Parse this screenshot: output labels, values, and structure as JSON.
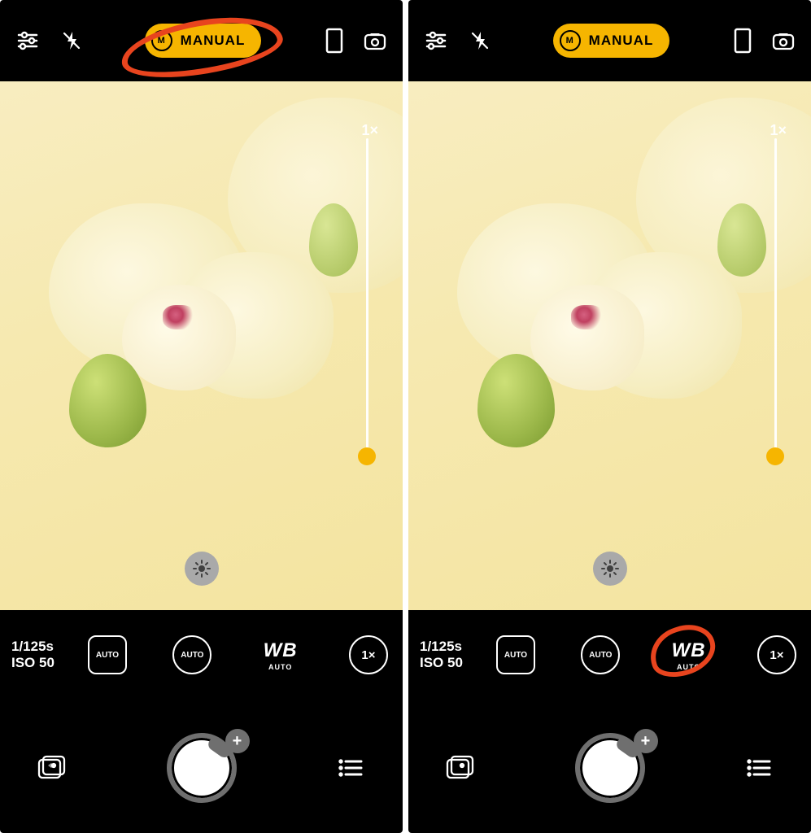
{
  "mode": {
    "badge_letter": "M",
    "label": "MANUAL"
  },
  "zoom": {
    "label": "1×"
  },
  "exposure": {
    "shutter": "1/125s",
    "iso": "ISO 50"
  },
  "controls": {
    "focus_badge": "AUTO",
    "ev_badge": "AUTO",
    "wb_label": "WB",
    "wb_sub": "AUTO",
    "zoom_value": "1×"
  },
  "shutter": {
    "plus": "+"
  },
  "colors": {
    "accent": "#f6b500",
    "annotation": "#e8441e"
  },
  "left_pane": {
    "highlight": "manual-mode"
  },
  "right_pane": {
    "highlight": "white-balance"
  }
}
